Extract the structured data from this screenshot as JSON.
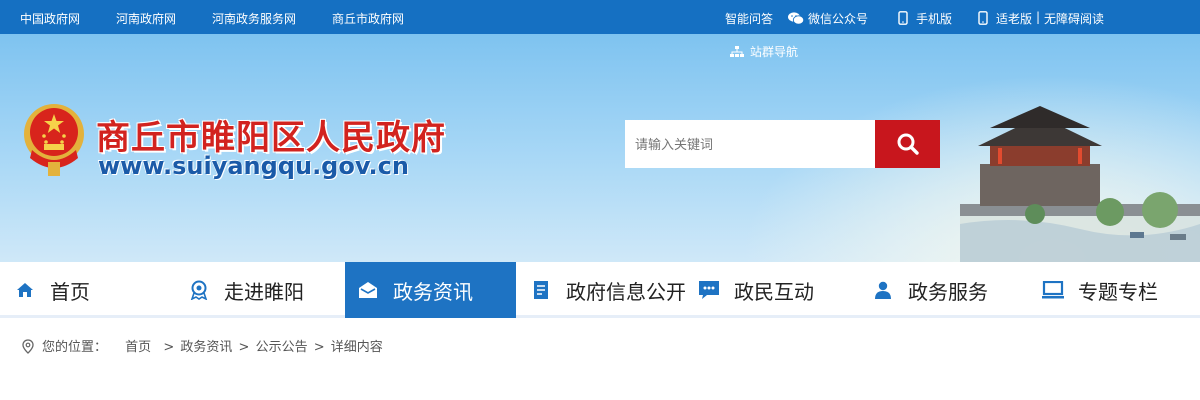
{
  "topbar": {
    "links": [
      "中国政府网",
      "河南政府网",
      "河南政务服务网",
      "商丘市政府网"
    ],
    "smart_qa": "智能问答",
    "wechat": "微信公众号",
    "mobile": "手机版",
    "elder": "适老版",
    "separator": "|",
    "accessible": "无障碍阅读"
  },
  "header": {
    "site_nav": "站群导航",
    "title": "商丘市睢阳区人民政府",
    "url": "www.suiyangqu.gov.cn",
    "search_placeholder": "请输入关键词"
  },
  "nav": {
    "items": [
      {
        "label": "首页",
        "icon": "home-icon"
      },
      {
        "label": "走进睢阳",
        "icon": "badge-icon"
      },
      {
        "label": "政务资讯",
        "icon": "envelope-icon",
        "active": true
      },
      {
        "label": "政府信息公开",
        "icon": "document-icon"
      },
      {
        "label": "政民互动",
        "icon": "chat-icon"
      },
      {
        "label": "政务服务",
        "icon": "user-icon"
      },
      {
        "label": "专题专栏",
        "icon": "monitor-icon"
      }
    ]
  },
  "breadcrumb": {
    "prefix": "您的位置：",
    "items": [
      "首页",
      "政务资讯",
      "公示公告",
      "详细内容"
    ],
    "sep": ">"
  },
  "colors": {
    "topbar": "#1570c2",
    "nav_active": "#1e73c3",
    "search_button": "#c8161d",
    "title_red": "#d2231f",
    "url_blue": "#1a5aa8"
  }
}
